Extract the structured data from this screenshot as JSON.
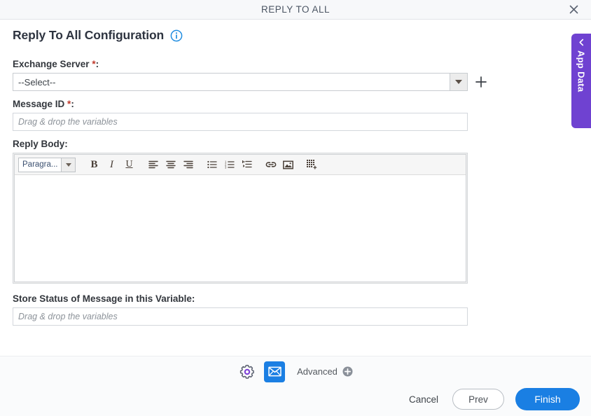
{
  "window": {
    "title": "REPLY TO ALL",
    "close_icon": "close-icon"
  },
  "header": {
    "title": "Reply To All Configuration",
    "info_icon": "info-icon"
  },
  "form": {
    "exchange_server": {
      "label": "Exchange Server ",
      "required_mark": "*",
      "label_suffix": ":",
      "selected_value": "--Select--",
      "add_icon": "plus-icon",
      "dropdown_icon": "chevron-down-icon"
    },
    "message_id": {
      "label": "Message ID ",
      "required_mark": "*",
      "label_suffix": ":",
      "value": "",
      "placeholder": "Drag & drop the variables"
    },
    "reply_body": {
      "label": "Reply Body:",
      "content": "",
      "toolbar": {
        "paragraph_label": "Paragra...",
        "buttons": [
          {
            "name": "bold-icon",
            "label": "B"
          },
          {
            "name": "italic-icon",
            "label": "I"
          },
          {
            "name": "underline-icon",
            "label": "U"
          },
          {
            "name": "align-left-icon",
            "label": ""
          },
          {
            "name": "align-center-icon",
            "label": ""
          },
          {
            "name": "align-right-icon",
            "label": ""
          },
          {
            "name": "bullet-list-icon",
            "label": ""
          },
          {
            "name": "numbered-list-icon",
            "label": ""
          },
          {
            "name": "indent-icon",
            "label": ""
          },
          {
            "name": "link-icon",
            "label": ""
          },
          {
            "name": "image-icon",
            "label": ""
          },
          {
            "name": "insert-table-icon",
            "label": ""
          }
        ]
      }
    },
    "store_status": {
      "label": "Store Status of Message in this Variable:",
      "value": "",
      "placeholder": "Drag & drop the variables"
    }
  },
  "footer": {
    "settings_icon": "gear-icon",
    "mail_icon": "envelope-icon",
    "advanced_label": "Advanced",
    "advanced_add_icon": "plus-circle-icon",
    "cancel_label": "Cancel",
    "prev_label": "Prev",
    "finish_label": "Finish"
  },
  "side_panel": {
    "label": "App Data",
    "collapse_icon": "chevron-left-icon"
  },
  "colors": {
    "accent_blue": "#1a7fe3",
    "purple": "#6f42d1",
    "required_red": "#c0392b",
    "info_blue": "#1f8ce0"
  }
}
